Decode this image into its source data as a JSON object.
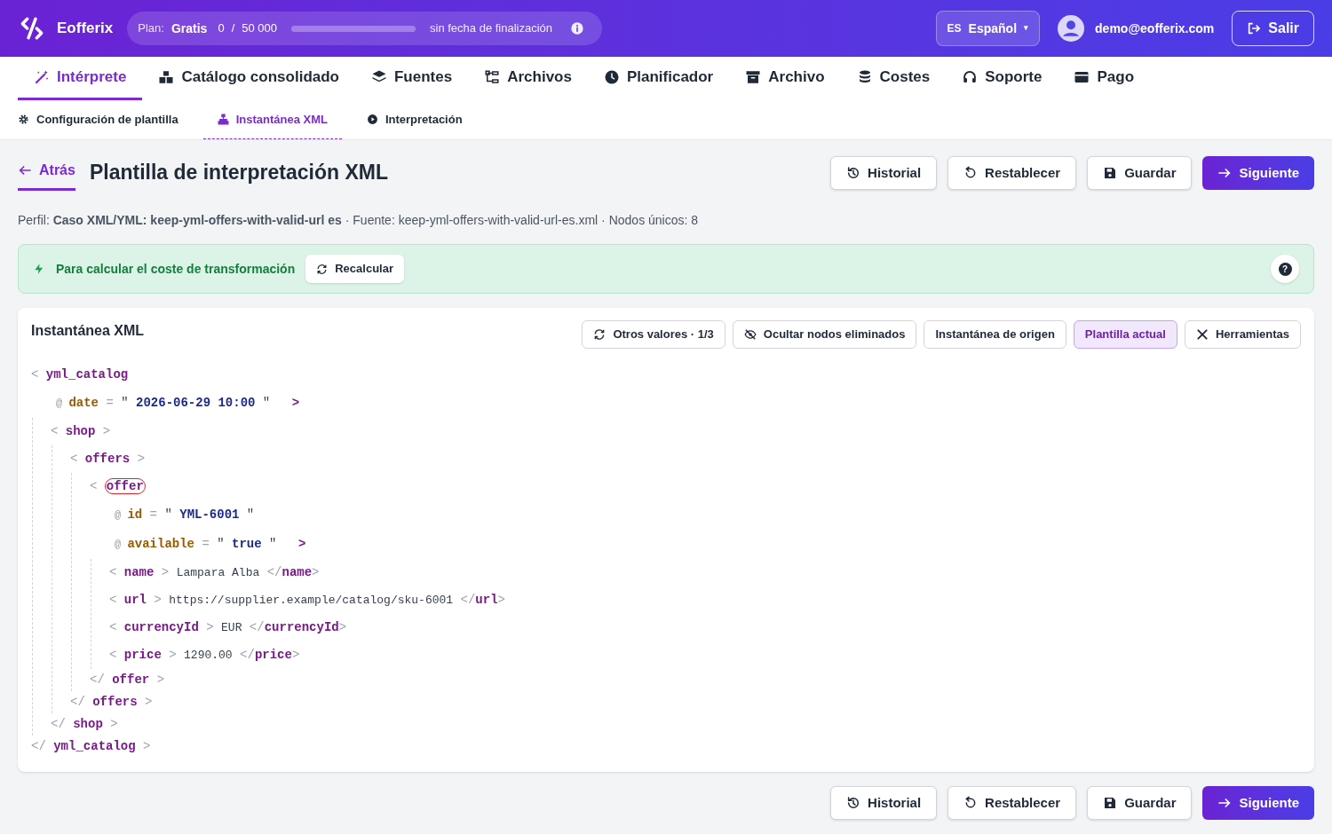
{
  "header": {
    "brand": "Eofferix",
    "plan": {
      "label": "Plan:",
      "name": "Gratis",
      "used": "0",
      "separator": "/",
      "limit": "50 000",
      "level": 0,
      "expiry": "sin fecha de finalización"
    },
    "language": {
      "code": "ES",
      "name": "Español",
      "caret": "▾"
    },
    "user": "demo@eofferix.com",
    "logout": "Salir"
  },
  "tabs": [
    {
      "label": "Intérprete",
      "selected": true
    },
    {
      "label": "Catálogo consolidado",
      "selected": false
    },
    {
      "label": "Fuentes",
      "selected": false
    },
    {
      "label": "Archivos",
      "selected": false
    },
    {
      "label": "Planificador",
      "selected": false
    },
    {
      "label": "Archivo",
      "selected": false
    },
    {
      "label": "Costes",
      "selected": false
    },
    {
      "label": "Soporte",
      "selected": false
    },
    {
      "label": "Pago",
      "selected": false
    }
  ],
  "subtabs": [
    {
      "label": "Configuración de plantilla",
      "selected": false
    },
    {
      "label": "Instantánea XML",
      "selected": true
    },
    {
      "label": "Interpretación",
      "selected": false
    }
  ],
  "back": "Atrás",
  "title": "Plantilla de interpretación XML",
  "actions": [
    "Historial",
    "Restablecer",
    "Guardar",
    "Siguiente"
  ],
  "info": "Perfil: **Caso XML/YML: keep-yml-offers-with-valid-url es** · Fuente: keep-yml-offers-with-valid-url-es.xml · Nodos únicos: 8",
  "banner": {
    "text": "Para calcular el coste de transformación",
    "button": "Recalcular",
    "help": "?"
  },
  "snapshot": {
    "title": "Instantánea XML",
    "tools": [
      {
        "label": "Otros valores · 1/3",
        "selected": false
      },
      {
        "label": "Ocultar nodos eliminados",
        "selected": false
      },
      {
        "label": "Instantánea de origen",
        "selected": false
      },
      {
        "label": "Plantilla actual",
        "selected": true
      },
      {
        "label": "Herramientas",
        "selected": false
      }
    ],
    "syntax": {
      "open": "<",
      "close": ">",
      "end": "</",
      "attr": "@",
      "eq": "=",
      "quote": "\""
    },
    "xml": {
      "name": "yml_catalog",
      "close_name": "yml_catalog",
      "highlighted": false,
      "attributes": [
        {
          "name": "date",
          "value": "2026-06-29 10:00"
        }
      ],
      "children": [
        {
          "name": "shop",
          "close_name": "shop",
          "highlighted": false,
          "children": [
            {
              "name": "offers",
              "close_name": "offers",
              "highlighted": false,
              "children": [
                {
                  "name": "offer",
                  "close_name": "offer",
                  "highlighted": true,
                  "attributes": [
                    {
                      "name": "id",
                      "value": "YML-6001"
                    },
                    {
                      "name": "available",
                      "value": "true"
                    }
                  ],
                  "children": [
                    {
                      "kind": "leaf",
                      "name": "name",
                      "text": "Lampara Alba",
                      "close_name": "name"
                    },
                    {
                      "kind": "leaf",
                      "name": "url",
                      "text": "https://supplier.example/catalog/sku-6001",
                      "close_name": "url"
                    },
                    {
                      "kind": "leaf",
                      "name": "currencyId",
                      "text": "EUR",
                      "close_name": "currencyId"
                    },
                    {
                      "kind": "leaf",
                      "name": "price",
                      "text": "1290.00",
                      "close_name": "price"
                    }
                  ]
                }
              ]
            }
          ]
        }
      ]
    }
  },
  "footer_actions": [
    "Historial",
    "Restablecer",
    "Guardar",
    "Siguiente"
  ]
}
